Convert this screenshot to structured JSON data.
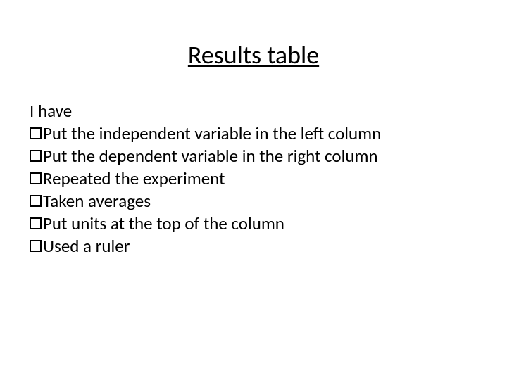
{
  "title": "Results table",
  "intro": "I have",
  "items": [
    "Put the independent variable in the left column",
    "Put the dependent variable in the right column",
    "Repeated the experiment",
    "Taken averages",
    "Put units at the top of the column",
    "Used a ruler"
  ]
}
